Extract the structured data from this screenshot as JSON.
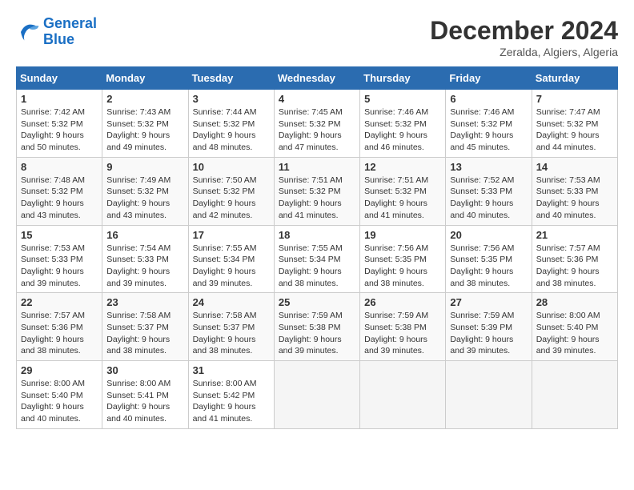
{
  "header": {
    "logo_line1": "General",
    "logo_line2": "Blue",
    "month": "December 2024",
    "location": "Zeralda, Algiers, Algeria"
  },
  "days_of_week": [
    "Sunday",
    "Monday",
    "Tuesday",
    "Wednesday",
    "Thursday",
    "Friday",
    "Saturday"
  ],
  "weeks": [
    [
      {
        "day": "1",
        "rise": "7:42 AM",
        "set": "5:32 PM",
        "daylight": "9 hours and 50 minutes."
      },
      {
        "day": "2",
        "rise": "7:43 AM",
        "set": "5:32 PM",
        "daylight": "9 hours and 49 minutes."
      },
      {
        "day": "3",
        "rise": "7:44 AM",
        "set": "5:32 PM",
        "daylight": "9 hours and 48 minutes."
      },
      {
        "day": "4",
        "rise": "7:45 AM",
        "set": "5:32 PM",
        "daylight": "9 hours and 47 minutes."
      },
      {
        "day": "5",
        "rise": "7:46 AM",
        "set": "5:32 PM",
        "daylight": "9 hours and 46 minutes."
      },
      {
        "day": "6",
        "rise": "7:46 AM",
        "set": "5:32 PM",
        "daylight": "9 hours and 45 minutes."
      },
      {
        "day": "7",
        "rise": "7:47 AM",
        "set": "5:32 PM",
        "daylight": "9 hours and 44 minutes."
      }
    ],
    [
      {
        "day": "8",
        "rise": "7:48 AM",
        "set": "5:32 PM",
        "daylight": "9 hours and 43 minutes."
      },
      {
        "day": "9",
        "rise": "7:49 AM",
        "set": "5:32 PM",
        "daylight": "9 hours and 43 minutes."
      },
      {
        "day": "10",
        "rise": "7:50 AM",
        "set": "5:32 PM",
        "daylight": "9 hours and 42 minutes."
      },
      {
        "day": "11",
        "rise": "7:51 AM",
        "set": "5:32 PM",
        "daylight": "9 hours and 41 minutes."
      },
      {
        "day": "12",
        "rise": "7:51 AM",
        "set": "5:32 PM",
        "daylight": "9 hours and 41 minutes."
      },
      {
        "day": "13",
        "rise": "7:52 AM",
        "set": "5:33 PM",
        "daylight": "9 hours and 40 minutes."
      },
      {
        "day": "14",
        "rise": "7:53 AM",
        "set": "5:33 PM",
        "daylight": "9 hours and 40 minutes."
      }
    ],
    [
      {
        "day": "15",
        "rise": "7:53 AM",
        "set": "5:33 PM",
        "daylight": "9 hours and 39 minutes."
      },
      {
        "day": "16",
        "rise": "7:54 AM",
        "set": "5:33 PM",
        "daylight": "9 hours and 39 minutes."
      },
      {
        "day": "17",
        "rise": "7:55 AM",
        "set": "5:34 PM",
        "daylight": "9 hours and 39 minutes."
      },
      {
        "day": "18",
        "rise": "7:55 AM",
        "set": "5:34 PM",
        "daylight": "9 hours and 38 minutes."
      },
      {
        "day": "19",
        "rise": "7:56 AM",
        "set": "5:35 PM",
        "daylight": "9 hours and 38 minutes."
      },
      {
        "day": "20",
        "rise": "7:56 AM",
        "set": "5:35 PM",
        "daylight": "9 hours and 38 minutes."
      },
      {
        "day": "21",
        "rise": "7:57 AM",
        "set": "5:36 PM",
        "daylight": "9 hours and 38 minutes."
      }
    ],
    [
      {
        "day": "22",
        "rise": "7:57 AM",
        "set": "5:36 PM",
        "daylight": "9 hours and 38 minutes."
      },
      {
        "day": "23",
        "rise": "7:58 AM",
        "set": "5:37 PM",
        "daylight": "9 hours and 38 minutes."
      },
      {
        "day": "24",
        "rise": "7:58 AM",
        "set": "5:37 PM",
        "daylight": "9 hours and 38 minutes."
      },
      {
        "day": "25",
        "rise": "7:59 AM",
        "set": "5:38 PM",
        "daylight": "9 hours and 39 minutes."
      },
      {
        "day": "26",
        "rise": "7:59 AM",
        "set": "5:38 PM",
        "daylight": "9 hours and 39 minutes."
      },
      {
        "day": "27",
        "rise": "7:59 AM",
        "set": "5:39 PM",
        "daylight": "9 hours and 39 minutes."
      },
      {
        "day": "28",
        "rise": "8:00 AM",
        "set": "5:40 PM",
        "daylight": "9 hours and 39 minutes."
      }
    ],
    [
      {
        "day": "29",
        "rise": "8:00 AM",
        "set": "5:40 PM",
        "daylight": "9 hours and 40 minutes."
      },
      {
        "day": "30",
        "rise": "8:00 AM",
        "set": "5:41 PM",
        "daylight": "9 hours and 40 minutes."
      },
      {
        "day": "31",
        "rise": "8:00 AM",
        "set": "5:42 PM",
        "daylight": "9 hours and 41 minutes."
      },
      null,
      null,
      null,
      null
    ]
  ]
}
